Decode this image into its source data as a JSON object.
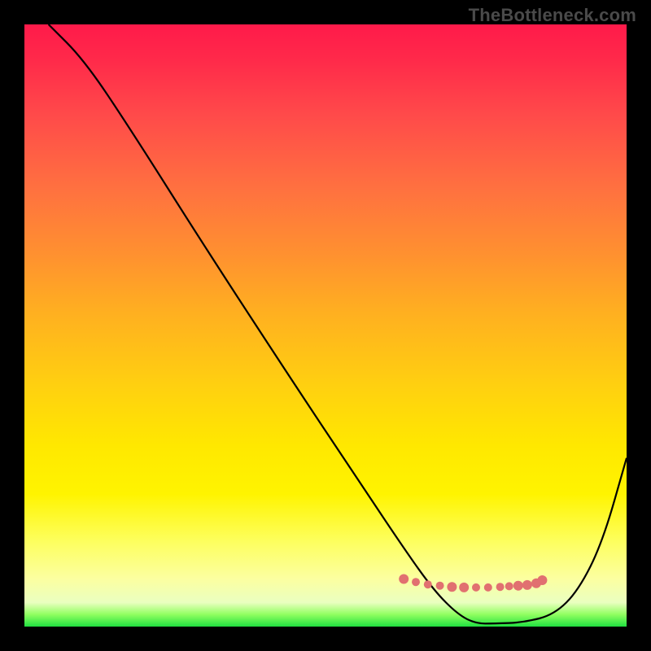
{
  "watermark": "TheBottleneck.com",
  "chart_data": {
    "type": "line",
    "title": "",
    "xlabel": "",
    "ylabel": "",
    "xlim": [
      0,
      100
    ],
    "ylim": [
      0,
      100
    ],
    "background": "rainbow-gradient-red-to-green",
    "series": [
      {
        "name": "bottleneck-curve",
        "color": "#000000",
        "x": [
          4,
          10,
          18,
          30,
          45,
          55,
          63,
          68,
          72,
          75,
          78,
          83,
          88,
          92,
          96,
          100
        ],
        "y": [
          100,
          94,
          82,
          63,
          40,
          25,
          13,
          6,
          2,
          0.5,
          0.5,
          0.7,
          2,
          6,
          14,
          28
        ]
      }
    ],
    "markers": {
      "name": "highlighted-range",
      "color": "#e17070",
      "plot_x": [
        63,
        65,
        67,
        69,
        71,
        73,
        75,
        77,
        79,
        80.5,
        82,
        83.5,
        85,
        86
      ],
      "plot_y_percent_from_top": [
        92.1,
        92.6,
        93.0,
        93.2,
        93.4,
        93.5,
        93.5,
        93.5,
        93.4,
        93.3,
        93.2,
        93.1,
        92.8,
        92.3
      ],
      "radius": [
        6,
        5,
        5,
        5,
        6,
        6,
        5,
        5,
        5,
        5,
        6,
        6,
        6,
        6
      ]
    }
  }
}
